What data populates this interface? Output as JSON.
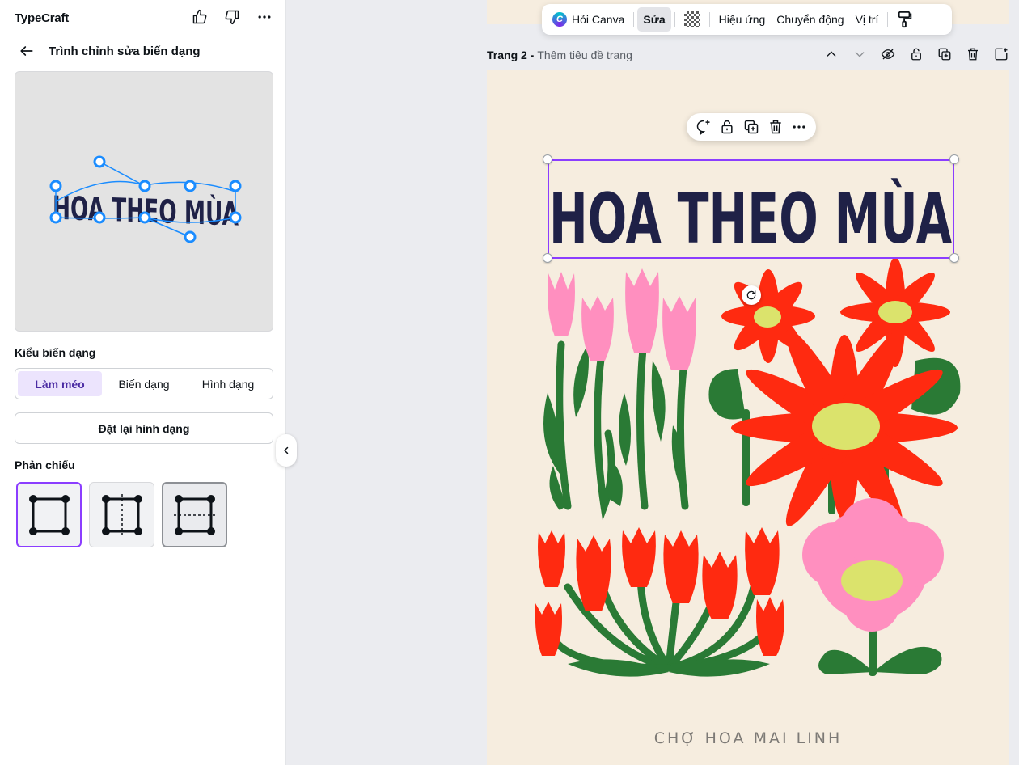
{
  "panel": {
    "app_title": "TypeCraft",
    "back_title": "Trình chỉnh sửa biến dạng",
    "preview_text": "HOA THEO MÙA",
    "warp_section_label": "Kiểu biến dạng",
    "warp_modes": [
      "Làm méo",
      "Biến dạng",
      "Hình dạng"
    ],
    "reset_label": "Đặt lại hình dạng",
    "mirror_section_label": "Phản chiếu"
  },
  "toolbar": {
    "ask_canva": "Hỏi Canva",
    "edit": "Sửa",
    "effects": "Hiệu ứng",
    "animate": "Chuyển động",
    "position": "Vị trí"
  },
  "page": {
    "label": "Trang 2 -",
    "subtitle": "Thêm tiêu đề trang",
    "headline": "HOA THEO MÙA",
    "footer": "CHỢ HOA MAI LINH"
  },
  "colors": {
    "accent": "#8b3dff",
    "handle_blue": "#1a8cff",
    "headline": "#1f2147",
    "page_bg": "#f6eddf",
    "flower_red": "#ff2a10",
    "flower_pink": "#ff8fbf",
    "leaf_green": "#2a7a35",
    "center_yellow": "#dbe36c"
  }
}
